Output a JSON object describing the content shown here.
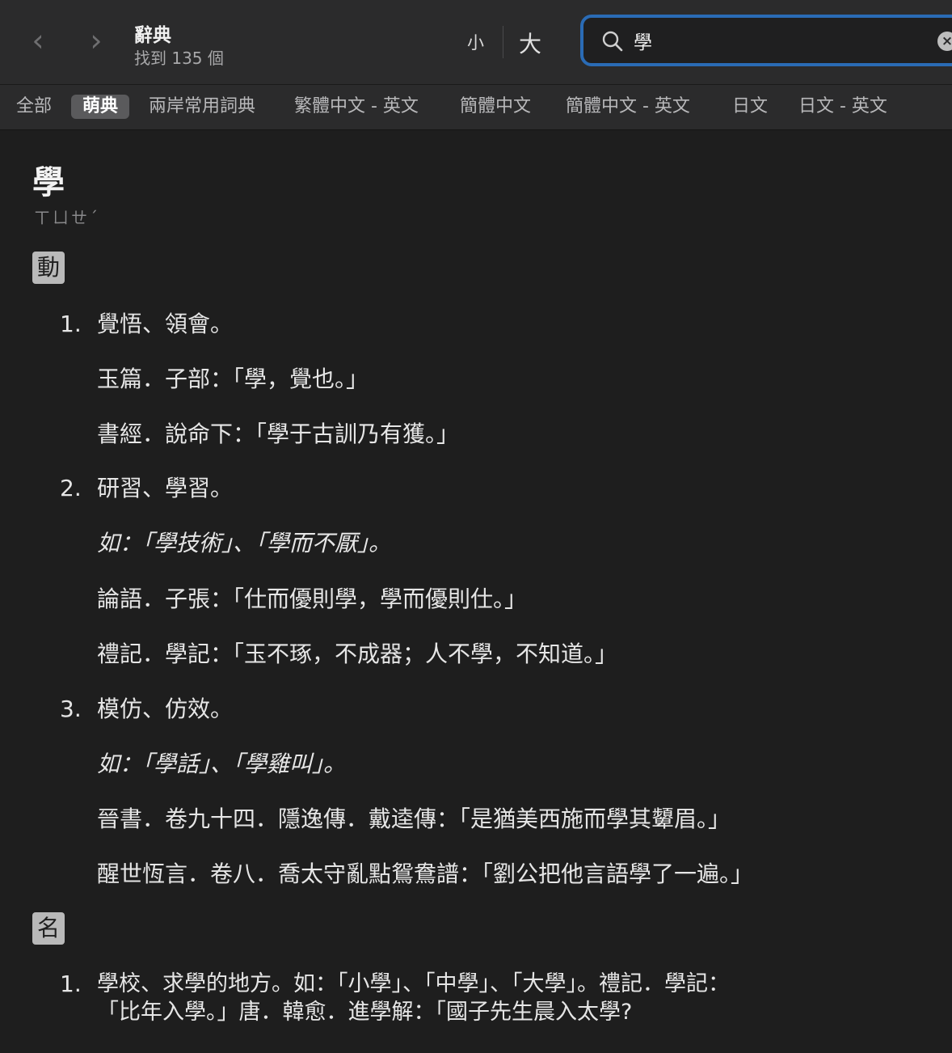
{
  "header": {
    "title": "辭典",
    "subtitle": "找到 135 個",
    "back_icon": "‹",
    "forward_icon": "›",
    "font_small": "小",
    "font_large": "大",
    "search": {
      "value": "學",
      "clear_icon": "×"
    }
  },
  "tabs": [
    {
      "label": "全部",
      "active": false
    },
    {
      "label": "萌典",
      "active": true
    },
    {
      "label": "兩岸常用詞典",
      "active": false
    },
    {
      "label": "繁體中文 - 英文",
      "active": false
    },
    {
      "label": "簡體中文",
      "active": false
    },
    {
      "label": "簡體中文 - 英文",
      "active": false
    },
    {
      "label": "日文",
      "active": false
    },
    {
      "label": "日文 - 英文",
      "active": false
    }
  ],
  "entry": {
    "headword": "學",
    "bopomofo": "ㄒㄩㄝˊ",
    "pos_verb": "動",
    "pos_noun": "名",
    "verb_senses": [
      {
        "num": "1.",
        "def": "覺悟、領會。",
        "quotes": [
          "玉篇．子部：「學，覺也。」",
          "書經．說命下：「學于古訓乃有獲。」"
        ]
      },
      {
        "num": "2.",
        "def": "研習、學習。",
        "example": "如：「學技術」、「學而不厭」。",
        "quotes": [
          "論語．子張：「仕而優則學，學而優則仕。」",
          "禮記．學記：「玉不琢，不成器；人不學，不知道。」"
        ]
      },
      {
        "num": "3.",
        "def": "模仿、仿效。",
        "example": "如：「學話」、「學雞叫」。",
        "quotes": [
          "晉書．卷九十四．隱逸傳．戴逵傳：「是猶美西施而學其顰眉。」",
          "醒世恆言．卷八．喬太守亂點鴛鴦譜：「劉公把他言語學了一遍。」"
        ]
      }
    ],
    "noun_senses": [
      {
        "num": "1.",
        "line1": "學校、求學的地方。如：「小學」、「中學」、「大學」。禮記．學記：",
        "line2": "「比年入學。」唐．韓愈．進學解：「國子先生晨入太學?"
      }
    ]
  }
}
